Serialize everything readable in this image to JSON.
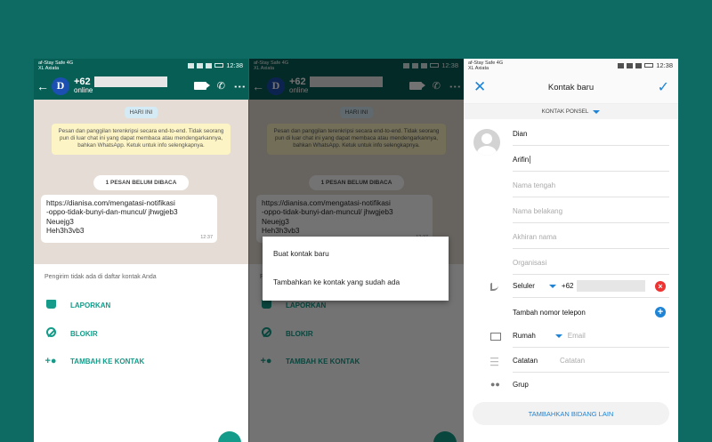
{
  "status_bar": {
    "carrier_line1": "af-Stay Safe 4G",
    "carrier_line2": "XL Axiata",
    "time": "12:38"
  },
  "whatsapp": {
    "contact_prefix": "+62",
    "contact_status": "online",
    "date_label": "HARI INI",
    "encryption_notice": "Pesan dan panggilan terenkripsi secara end-to-end. Tidak seorang pun di luar chat ini yang dapat membaca atau mendengarkannya, bahkan WhatsApp. Ketuk untuk info selengkapnya.",
    "unread_label": "1 PESAN BELUM DIBACA",
    "message_lines": [
      "https://dianisa.com/mengatasi-notifikasi",
      "-oppo-tidak-bunyi-dan-muncul/ jhwgjeb3",
      "Neuejg3",
      "Heh3h3vb3"
    ],
    "message_time": "12:37",
    "unknown_sender_note": "Pengirim tidak ada di daftar kontak Anda",
    "actions": {
      "report": "LAPORKAN",
      "block": "BLOKIR",
      "add_contact": "TAMBAH KE KONTAK"
    },
    "avatar_letter": "D"
  },
  "popup": {
    "create_new": "Buat kontak baru",
    "add_existing": "Tambahkan ke kontak yang sudah ada"
  },
  "contacts": {
    "title": "Kontak baru",
    "account_label": "KONTAK PONSEL",
    "first_name": "Dian",
    "last_name_value": "Arifin",
    "middle_name_placeholder": "Nama tengah",
    "family_name_placeholder": "Nama belakang",
    "suffix_placeholder": "Akhiran nama",
    "organization_placeholder": "Organisasi",
    "phone_type": "Seluler",
    "phone_prefix": "+62",
    "add_phone_label": "Tambah nomor telepon",
    "email_type": "Rumah",
    "email_placeholder": "Email",
    "notes_label": "Catatan",
    "notes_placeholder": "Catatan",
    "group_label": "Grup",
    "add_field_button": "TAMBAHKAN BIDANG LAIN"
  },
  "colors": {
    "background": "#0d6b63",
    "wa_header": "#075e54",
    "wa_accent": "#149b89",
    "contacts_accent": "#1f84d6",
    "delete_red": "#e33333"
  }
}
